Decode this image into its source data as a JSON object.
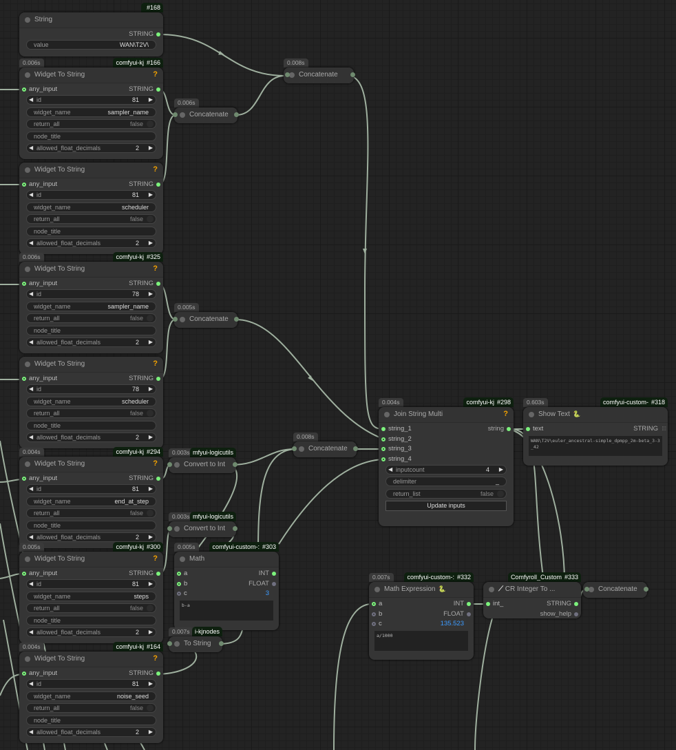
{
  "canvas": {
    "wire_color": "#9fb09f",
    "background": "#232323",
    "node_color": "#353535",
    "badge_color": "#0e200f",
    "accent_value_color": "#3d9bff"
  },
  "nodes": [
    {
      "key": "string168",
      "title": "String",
      "badge_id": "#168",
      "outputs_only": true,
      "slots": [
        {
          "out": "STRING",
          "out_state": "fill"
        }
      ],
      "widgets": [
        {
          "type": "text",
          "label": "value",
          "value": "WAN\\T2V\\"
        }
      ]
    },
    {
      "key": "w166",
      "title": "Widget To String",
      "help": "?",
      "timing": "0.006s",
      "badge_pack": "comfyui-kj",
      "badge_id": "#166",
      "slots": [
        {
          "in": "any_input",
          "in_state": "ring",
          "out": "STRING",
          "out_state": "fill"
        }
      ],
      "widgets": [
        {
          "type": "number",
          "label": "id",
          "value": "81"
        },
        {
          "type": "text",
          "label": "widget_name",
          "value": "sampler_name"
        },
        {
          "type": "toggle",
          "label": "return_all",
          "value": "false"
        },
        {
          "type": "text",
          "label": "node_title",
          "value": ""
        },
        {
          "type": "number",
          "label": "allowed_float_decimals",
          "value": "2"
        }
      ]
    },
    {
      "key": "wsched",
      "title": "Widget To String",
      "help": "?",
      "slots": [
        {
          "in": "any_input",
          "in_state": "ring",
          "out": "STRING",
          "out_state": "fill"
        }
      ],
      "widgets": [
        {
          "type": "number",
          "label": "id",
          "value": "81"
        },
        {
          "type": "text",
          "label": "widget_name",
          "value": "scheduler"
        },
        {
          "type": "toggle",
          "label": "return_all",
          "value": "false"
        },
        {
          "type": "text",
          "label": "node_title",
          "value": ""
        },
        {
          "type": "number",
          "label": "allowed_float_decimals",
          "value": "2"
        }
      ]
    },
    {
      "key": "w325",
      "title": "Widget To String",
      "help": "?",
      "timing": "0.006s",
      "badge_pack": "comfyui-kj",
      "badge_id": "#325",
      "slots": [
        {
          "in": "any_input",
          "in_state": "ring",
          "out": "STRING",
          "out_state": "fill"
        }
      ],
      "widgets": [
        {
          "type": "number",
          "label": "id",
          "value": "78"
        },
        {
          "type": "text",
          "label": "widget_name",
          "value": "sampler_name"
        },
        {
          "type": "toggle",
          "label": "return_all",
          "value": "false"
        },
        {
          "type": "text",
          "label": "node_title",
          "value": ""
        },
        {
          "type": "number",
          "label": "allowed_float_decimals",
          "value": "2"
        }
      ]
    },
    {
      "key": "w4",
      "title": "Widget To String",
      "help": "?",
      "slots": [
        {
          "in": "any_input",
          "in_state": "ring",
          "out": "STRING",
          "out_state": "fill"
        }
      ],
      "widgets": [
        {
          "type": "number",
          "label": "id",
          "value": "78"
        },
        {
          "type": "text",
          "label": "widget_name",
          "value": "scheduler"
        },
        {
          "type": "toggle",
          "label": "return_all",
          "value": "false"
        },
        {
          "type": "text",
          "label": "node_title",
          "value": ""
        },
        {
          "type": "number",
          "label": "allowed_float_decimals",
          "value": "2"
        }
      ]
    },
    {
      "key": "w294",
      "title": "Widget To String",
      "help": "?",
      "timing": "0.004s",
      "badge_pack": "comfyui-kj",
      "badge_id": "#294",
      "slots": [
        {
          "in": "any_input",
          "in_state": "ring",
          "out": "STRING",
          "out_state": "fill"
        }
      ],
      "widgets": [
        {
          "type": "number",
          "label": "id",
          "value": "81"
        },
        {
          "type": "text",
          "label": "widget_name",
          "value": "end_at_step"
        },
        {
          "type": "toggle",
          "label": "return_all",
          "value": "false"
        },
        {
          "type": "text",
          "label": "node_title",
          "value": ""
        },
        {
          "type": "number",
          "label": "allowed_float_decimals",
          "value": "2"
        }
      ]
    },
    {
      "key": "w300",
      "title": "Widget To String",
      "help": "?",
      "timing": "0.005s",
      "badge_pack": "comfyui-kj",
      "badge_id": "#300",
      "slots": [
        {
          "in": "any_input",
          "in_state": "ring",
          "out": "STRING",
          "out_state": "fill"
        }
      ],
      "widgets": [
        {
          "type": "number",
          "label": "id",
          "value": "81"
        },
        {
          "type": "text",
          "label": "widget_name",
          "value": "steps"
        },
        {
          "type": "toggle",
          "label": "return_all",
          "value": "false"
        },
        {
          "type": "text",
          "label": "node_title",
          "value": ""
        },
        {
          "type": "number",
          "label": "allowed_float_decimals",
          "value": "2"
        }
      ]
    },
    {
      "key": "w164",
      "title": "Widget To String",
      "help": "?",
      "timing": "0.004s",
      "badge_pack": "comfyui-kj",
      "badge_id": "#164",
      "slots": [
        {
          "in": "any_input",
          "in_state": "ring",
          "out": "STRING",
          "out_state": "fill"
        }
      ],
      "widgets": [
        {
          "type": "number",
          "label": "id",
          "value": "81"
        },
        {
          "type": "text",
          "label": "widget_name",
          "value": "noise_seed"
        },
        {
          "type": "toggle",
          "label": "return_all",
          "value": "false"
        },
        {
          "type": "text",
          "label": "node_title",
          "value": ""
        },
        {
          "type": "number",
          "label": "allowed_float_decimals",
          "value": "2"
        }
      ]
    },
    {
      "key": "c1",
      "title": "Concatenate",
      "collapsed": true,
      "timing": "0.006s"
    },
    {
      "key": "c2",
      "title": "Concatenate",
      "collapsed": true,
      "timing": "0.008s"
    },
    {
      "key": "c3",
      "title": "Concatenate",
      "collapsed": true,
      "timing": "0.005s"
    },
    {
      "key": "cint1",
      "title": "Convert to Int",
      "collapsed": true,
      "timing": "0.003s",
      "badge_pack": "mfyui-logicutils"
    },
    {
      "key": "cint2",
      "title": "Convert to Int",
      "collapsed": true,
      "timing": "0.003s",
      "badge_pack": "mfyui-logicutils"
    },
    {
      "key": "math303",
      "title": "Math",
      "timing": "0.005s",
      "badge_pack": "comfyui-custom-:",
      "badge_id": "#303",
      "slots": [
        {
          "in": "a",
          "in_state": "ring",
          "out": "INT",
          "out_state": "fill"
        },
        {
          "in": "b",
          "in_state": "ring",
          "out": "FLOAT",
          "out_state": "grayfill"
        },
        {
          "in": "c",
          "in_state": "gray",
          "out": "3",
          "out_value": true
        }
      ],
      "textarea": "b-a"
    },
    {
      "key": "tostr",
      "title": "To String",
      "collapsed": true,
      "timing": "0.007s",
      "badge_pack": "i-kjnodes"
    },
    {
      "key": "c4",
      "title": "Concatenate",
      "collapsed": true,
      "timing": "0.008s"
    },
    {
      "key": "join298",
      "title": "Join String Multi",
      "help": "?",
      "timing": "0.004s",
      "badge_pack": "comfyui-kj",
      "badge_id": "#298",
      "slots": [
        {
          "in": "string_1",
          "in_state": "fill",
          "out": "string",
          "out_state": "fill"
        },
        {
          "in": "string_2",
          "in_state": "ring"
        },
        {
          "in": "string_3",
          "in_state": "ring"
        },
        {
          "in": "string_4",
          "in_state": "ring"
        }
      ],
      "widgets": [
        {
          "type": "number",
          "label": "inputcount",
          "value": "4"
        },
        {
          "type": "text",
          "label": "delimiter",
          "value": "_"
        },
        {
          "type": "toggle",
          "label": "return_list",
          "value": "false"
        },
        {
          "type": "button",
          "label": "Update inputs"
        }
      ]
    },
    {
      "key": "show318",
      "title": "Show Text",
      "snake": "🐍",
      "timing": "0.603s",
      "badge_pack": "comfyui-custom-",
      "badge_id": "#318",
      "slots": [
        {
          "in": "text",
          "in_state": "fill",
          "out": "STRING",
          "out_list": true
        }
      ],
      "textarea": "WAN\\T2V\\euler_ancestral-simple_dpmpp_2m-beta_3-3_42"
    },
    {
      "key": "mexpr332",
      "title": "Math Expression",
      "snake": "🐍",
      "timing": "0.007s",
      "badge_pack": "comfyui-custom-:",
      "badge_id": "#332",
      "slots": [
        {
          "in": "a",
          "in_state": "ring",
          "out": "INT",
          "out_state": "fill"
        },
        {
          "in": "b",
          "in_state": "gray",
          "out": "FLOAT",
          "out_state": "grayfill"
        },
        {
          "in": "c",
          "in_state": "gray",
          "out": "135.523",
          "out_value": true
        }
      ],
      "textarea": "a/1000"
    },
    {
      "key": "cr333",
      "title": "CR Integer To ...",
      "wrench": "🔧",
      "badge_pack": "Comfyroll_Custom",
      "badge_id": "#333",
      "slots": [
        {
          "in": "int_",
          "in_state": "fill",
          "out": "STRING",
          "out_state": "fill"
        },
        {
          "out": "show_help",
          "out_state": "grayfill"
        }
      ]
    },
    {
      "key": "c5",
      "title": "Concatenate",
      "collapsed": true
    }
  ]
}
